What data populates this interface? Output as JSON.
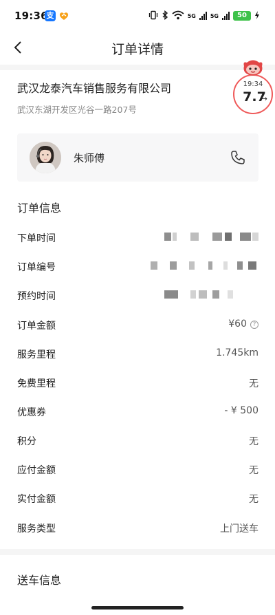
{
  "status_bar": {
    "time": "19:36",
    "alipay_badge": "支",
    "net1": "5G",
    "net2": "5G",
    "battery": "50"
  },
  "header": {
    "title": "订单详情"
  },
  "merchant": {
    "name": "武汉龙泰汽车销售服务有限公司",
    "address": "武汉东湖开发区光谷一路207号"
  },
  "timer": {
    "time": "19:34",
    "value": "7.7",
    "arrow": "→"
  },
  "driver": {
    "name": "朱师傅"
  },
  "order_info": {
    "title": "订单信息",
    "rows": [
      {
        "label": "下单时间",
        "value": ""
      },
      {
        "label": "订单编号",
        "value": ""
      },
      {
        "label": "预约时间",
        "value": ""
      },
      {
        "label": "订单金额",
        "value": "¥60"
      },
      {
        "label": "服务里程",
        "value": "1.745km"
      },
      {
        "label": "免费里程",
        "value": "无"
      },
      {
        "label": "优惠券",
        "value": "- ¥ 500"
      },
      {
        "label": "积分",
        "value": "无"
      },
      {
        "label": "应付金额",
        "value": "无"
      },
      {
        "label": "实付金额",
        "value": "无"
      },
      {
        "label": "服务类型",
        "value": "上门送车"
      }
    ]
  },
  "delivery_info": {
    "title": "送车信息"
  },
  "icons": {
    "back": "chevron-left-icon",
    "phone": "phone-icon",
    "help": "question-icon"
  },
  "colors": {
    "accent_red": "#ef5a5a",
    "divider": "#f5f5f5",
    "card_bg": "#f7f7f8",
    "battery_green": "#3ec24a"
  }
}
